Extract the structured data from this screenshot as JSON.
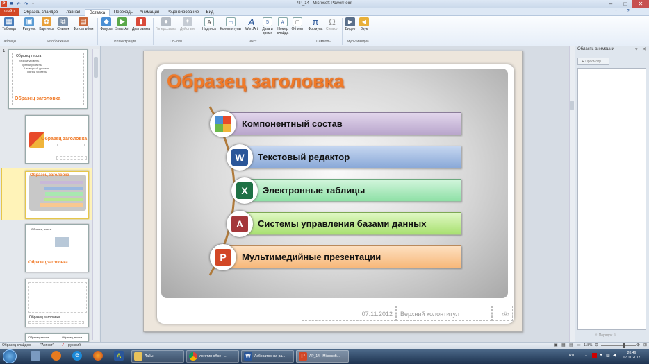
{
  "window": {
    "title": "ЛР_14  -  Microsoft PowerPoint"
  },
  "quick_access": {
    "icons": [
      "powerpoint-logo-icon",
      "save-icon",
      "undo-icon",
      "redo-icon",
      "customize-icon"
    ]
  },
  "tabs": {
    "file": "Файл",
    "items": [
      "Образец слайдов",
      "Главная",
      "Вставка",
      "Переходы",
      "Анимация",
      "Рецензирование",
      "Вид"
    ],
    "active": "Вставка"
  },
  "ribbon": {
    "tables": {
      "label": "Таблицы",
      "table": "Таблица"
    },
    "images": {
      "label": "Изображения",
      "picture": "Рисунок",
      "clipart": "Картинка",
      "screenshot": "Снимок",
      "album": "Фотоальбом"
    },
    "illustrations": {
      "label": "Иллюстрации",
      "shapes": "Фигуры",
      "smartart": "SmartArt",
      "chart": "Диаграмма"
    },
    "links": {
      "label": "Ссылки",
      "hyperlink": "Гиперссылка",
      "action": "Действие"
    },
    "text": {
      "label": "Текст",
      "textbox": "Надпись",
      "header": "Колонтитулы",
      "wordart": "WordArt",
      "datetime_1": "Дата и",
      "datetime_2": "время",
      "slidenum_1": "Номер",
      "slidenum_2": "слайда",
      "object": "Объект"
    },
    "symbols": {
      "label": "Символы",
      "equation": "Формула",
      "symbol": "Символ"
    },
    "media": {
      "label": "Мультимедиа",
      "video": "Видео",
      "audio": "Звук"
    }
  },
  "thumbnails": {
    "master_num": "1",
    "master": {
      "title": "Образец заголовка",
      "text": "Образец текста",
      "l2": "Второй уровень",
      "l3": "Третий уровень",
      "l4": "Четвертый уровень",
      "l5": "Пятый уровень"
    },
    "t2": {
      "title": "Образец заголовка"
    },
    "t3": {
      "title": "Образец заголовка"
    },
    "t4": {
      "title": "Образец заголовка",
      "text": "Образец текста"
    },
    "t5": {
      "title": "Образец заголовка"
    },
    "t6": {
      "text_a": "Образец текста",
      "text_b": "Образец текста"
    }
  },
  "slide": {
    "title": "Образец заголовка",
    "items": [
      {
        "label": "Компонентный состав",
        "icon": "office-logo-icon"
      },
      {
        "label": "Текстовый редактор",
        "icon": "word-icon"
      },
      {
        "label": "Электронные таблицы",
        "icon": "excel-icon"
      },
      {
        "label": "Системы управления базами данных",
        "icon": "access-icon"
      },
      {
        "label": "Мультимедийные презентации",
        "icon": "powerpoint-icon"
      }
    ],
    "footer": {
      "date": "07.11.2012",
      "text": "Верхний колонтитул",
      "num": "‹#›"
    }
  },
  "anim_panel": {
    "title": "Область анимации",
    "preview": "Просмотр",
    "order": "Порядок"
  },
  "status": {
    "view": "Образец слайдов",
    "theme": "\"Аспект\"",
    "lang": "русский",
    "zoom": "118%"
  },
  "taskbar": {
    "items": [
      "Лабы",
      "логотип office - ...",
      "Лабораторная ра...",
      "ЛР_14 - Microsoft..."
    ],
    "lang": "RU",
    "time": "20:46",
    "date": "07.11.2012"
  }
}
